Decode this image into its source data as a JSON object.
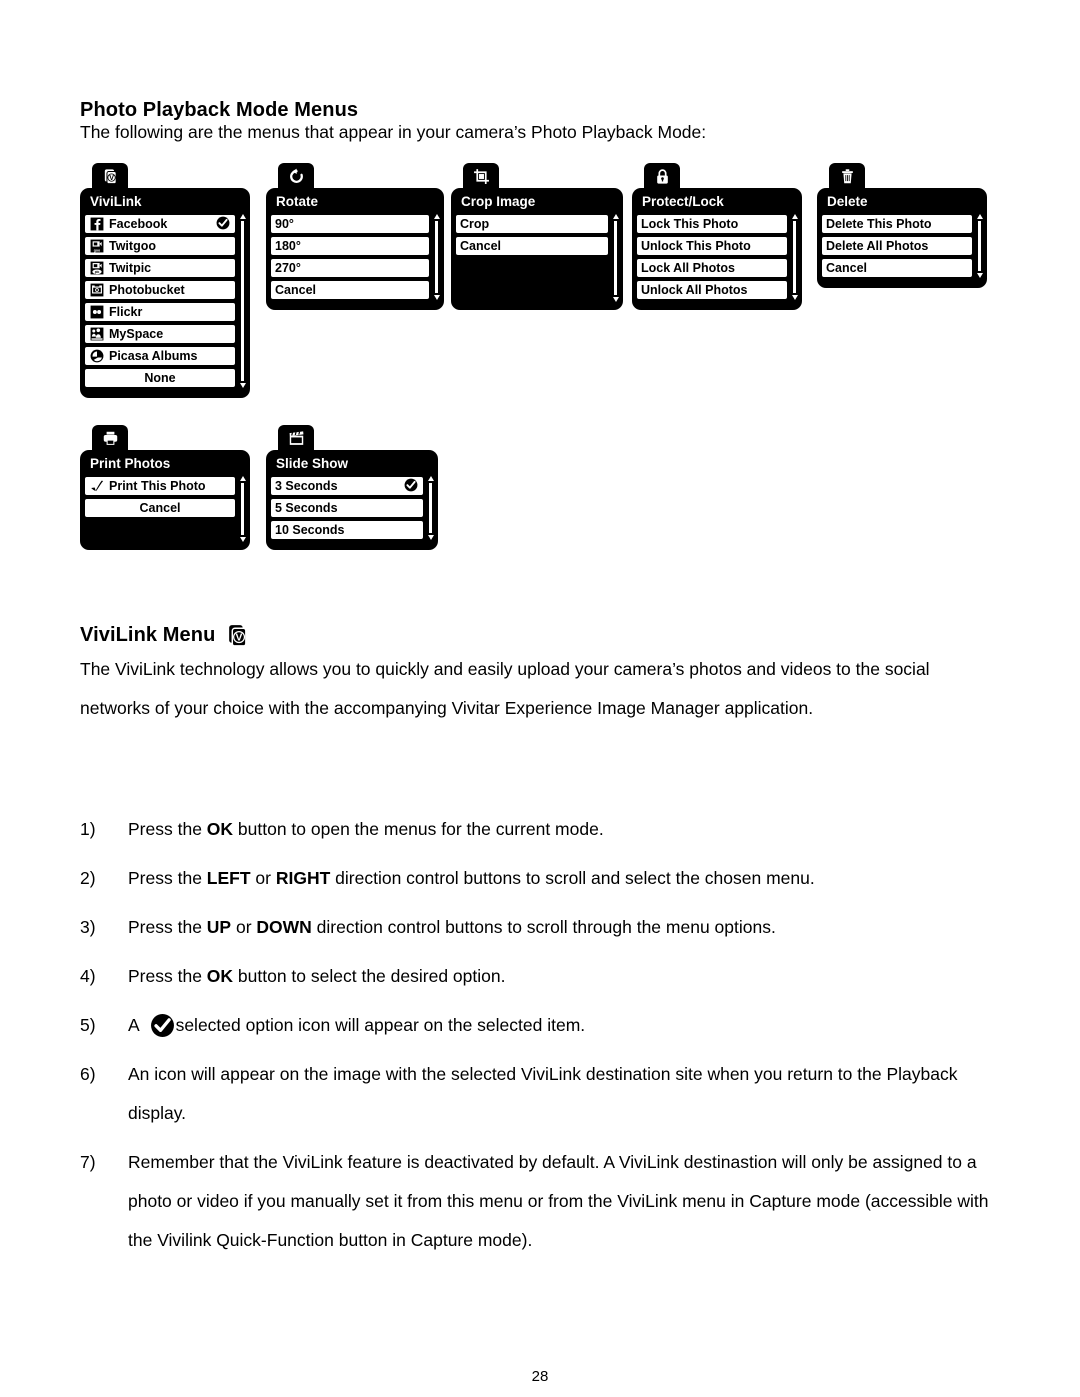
{
  "document": {
    "page_number": "28",
    "section_title": "Photo Playback Mode Menus",
    "intro": "The following are the menus that appear in your camera’s Photo Playback Mode:",
    "vivilink_title": "ViviLink Menu",
    "vivilink_paragraph": "The ViviLink technology allows you to quickly and easily upload your camera’s photos and videos to the social networks of your choice with the accompanying Vivitar Experience Image Manager application."
  },
  "colors": {
    "menu_background": "#000000",
    "menu_row_background": "#ffffff",
    "text": "#000000",
    "menu_title_text": "#ffffff"
  },
  "menus_row1": [
    {
      "id": "vivilink",
      "tab_icon": "vivilink-stack-icon",
      "title": "ViviLink",
      "rows": [
        {
          "label": "Facebook",
          "icon": "facebook-icon",
          "selected": true
        },
        {
          "label": "Twitgoo",
          "icon": "twitgoo-icon",
          "selected": false
        },
        {
          "label": "Twitpic",
          "icon": "twitpic-icon",
          "selected": false
        },
        {
          "label": "Photobucket",
          "icon": "photobucket-icon",
          "selected": false
        },
        {
          "label": "Flickr",
          "icon": "flickr-icon",
          "selected": false
        },
        {
          "label": "MySpace",
          "icon": "myspace-icon",
          "selected": false
        },
        {
          "label": "Picasa Albums",
          "icon": "picasa-icon",
          "selected": false
        },
        {
          "label": "None",
          "icon": "",
          "selected": false,
          "center": true
        }
      ]
    },
    {
      "id": "rotate",
      "tab_icon": "rotate-icon",
      "title": "Rotate",
      "rows": [
        {
          "label": "90°",
          "icon": "",
          "selected": false
        },
        {
          "label": "180°",
          "icon": "",
          "selected": false
        },
        {
          "label": "270°",
          "icon": "",
          "selected": false
        },
        {
          "label": "Cancel",
          "icon": "",
          "selected": false
        }
      ]
    },
    {
      "id": "crop-image",
      "tab_icon": "crop-icon",
      "title": "Crop Image",
      "rows": [
        {
          "label": "Crop",
          "icon": "",
          "selected": false
        },
        {
          "label": "Cancel",
          "icon": "",
          "selected": false
        }
      ],
      "filler_rows": 2
    },
    {
      "id": "protect-lock",
      "tab_icon": "lock-icon",
      "title": "Protect/Lock",
      "rows": [
        {
          "label": "Lock This Photo",
          "icon": "",
          "selected": false
        },
        {
          "label": "Unlock This Photo",
          "icon": "",
          "selected": false
        },
        {
          "label": "Lock All Photos",
          "icon": "",
          "selected": false
        },
        {
          "label": "Unlock All Photos",
          "icon": "",
          "selected": false
        }
      ]
    },
    {
      "id": "delete",
      "tab_icon": "trash-icon",
      "title": "Delete",
      "rows": [
        {
          "label": "Delete This Photo",
          "icon": "",
          "selected": false
        },
        {
          "label": "Delete All Photos",
          "icon": "",
          "selected": false
        },
        {
          "label": "Cancel",
          "icon": "",
          "selected": false
        }
      ]
    }
  ],
  "menus_row2": [
    {
      "id": "print-photos",
      "tab_icon": "printer-icon",
      "title": "Print Photos",
      "rows": [
        {
          "label": "Print This Photo",
          "icon": "print-check-icon",
          "selected": false
        },
        {
          "label": "Cancel",
          "icon": "",
          "selected": false,
          "center": true
        }
      ],
      "filler_rows": 1
    },
    {
      "id": "slide-show",
      "tab_icon": "clapperboard-icon",
      "title": "Slide Show",
      "rows": [
        {
          "label": "3 Seconds",
          "icon": "",
          "selected": true
        },
        {
          "label": "5 Seconds",
          "icon": "",
          "selected": false
        },
        {
          "label": "10 Seconds",
          "icon": "",
          "selected": false
        }
      ]
    }
  ],
  "steps": [
    {
      "num": "1)",
      "parts": [
        {
          "t": "Press the ",
          "b": false
        },
        {
          "t": "OK",
          "b": true
        },
        {
          "t": " button to open the menus for the current mode.",
          "b": false
        }
      ]
    },
    {
      "num": "2)",
      "parts": [
        {
          "t": "Press the ",
          "b": false
        },
        {
          "t": "LEFT",
          "b": true
        },
        {
          "t": " or ",
          "b": false
        },
        {
          "t": "RIGHT",
          "b": true
        },
        {
          "t": " direction control buttons to scroll and select the chosen menu.",
          "b": false
        }
      ]
    },
    {
      "num": "3)",
      "parts": [
        {
          "t": "Press the ",
          "b": false
        },
        {
          "t": "UP",
          "b": true
        },
        {
          "t": " or ",
          "b": false
        },
        {
          "t": "DOWN",
          "b": true
        },
        {
          "t": " direction control buttons to scroll through the menu options.",
          "b": false
        }
      ]
    },
    {
      "num": "4)",
      "parts": [
        {
          "t": "Press the ",
          "b": false
        },
        {
          "t": "OK",
          "b": true
        },
        {
          "t": " button to select the desired option.",
          "b": false
        }
      ]
    },
    {
      "num": "5)",
      "icon_after_index": 0,
      "icon": "selected-check-icon",
      "parts": [
        {
          "t": "A ",
          "b": false
        },
        {
          "t": "selected option icon will appear on the selected item.",
          "b": false
        }
      ]
    },
    {
      "num": "6)",
      "parts": [
        {
          "t": "An icon will appear on the image with the selected ViviLink destination site when you return to the Playback display.",
          "b": false
        }
      ]
    },
    {
      "num": "7)",
      "parts": [
        {
          "t": "Remember that the ViviLink feature is deactivated by default. A ViviLink destinastion will only be assigned to a photo or video if you manually set it from this menu or from the ViviLink menu in Capture mode (accessible with the Vivilink Quick-Function button in Capture mode).",
          "b": false
        }
      ]
    }
  ]
}
